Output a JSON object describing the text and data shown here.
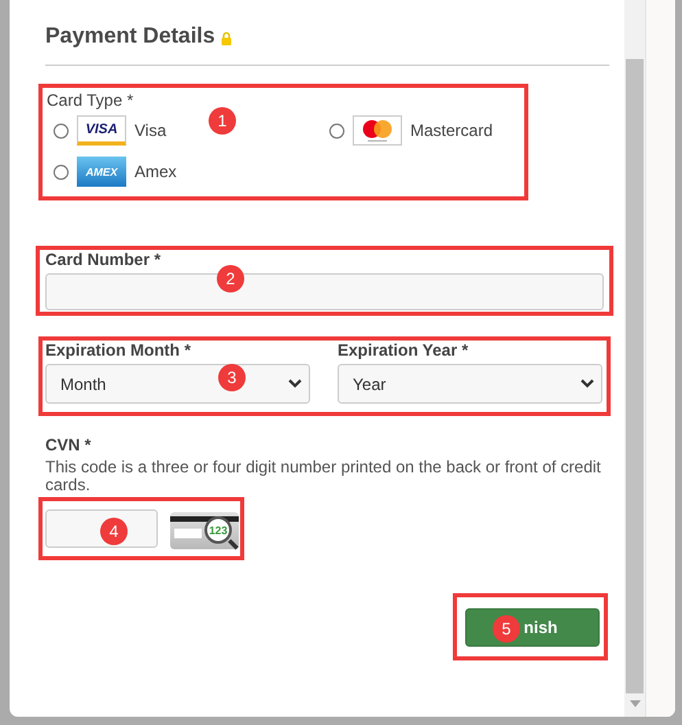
{
  "title": "Payment Details",
  "card_type": {
    "label": "Card Type *",
    "options": [
      {
        "label": "Visa",
        "kind": "visa",
        "logo_text": "VISA",
        "selected": false
      },
      {
        "label": "Mastercard",
        "kind": "mastercard",
        "selected": false
      },
      {
        "label": "Amex",
        "kind": "amex",
        "logo_text": "AMEX",
        "selected": false
      }
    ]
  },
  "card_number": {
    "label": "Card Number *"
  },
  "expiration_month": {
    "label": "Expiration Month *",
    "value": "Month"
  },
  "expiration_year": {
    "label": "Expiration Year *",
    "value": "Year"
  },
  "cvn": {
    "label": "CVN *",
    "help": "This code is a three or four digit number printed on the back or front of credit cards.",
    "image_text": "123"
  },
  "finish_button": {
    "label": "nish"
  },
  "annotations": [
    {
      "number": "1"
    },
    {
      "number": "2"
    },
    {
      "number": "3"
    },
    {
      "number": "4"
    },
    {
      "number": "5"
    }
  ]
}
